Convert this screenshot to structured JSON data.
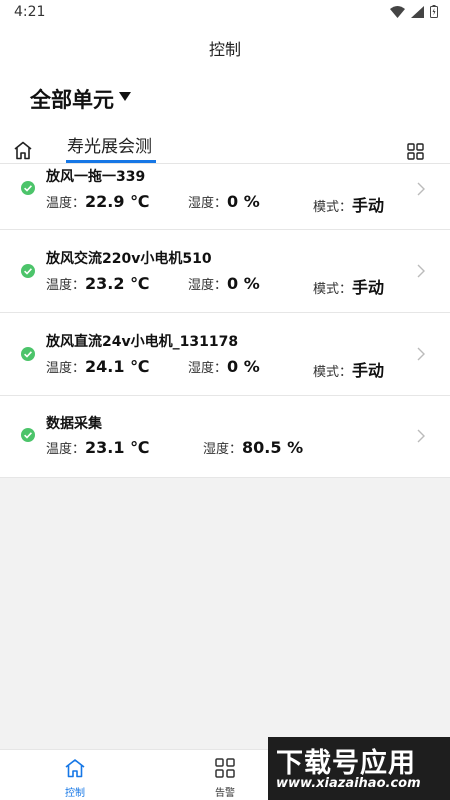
{
  "status": {
    "time": "4:21"
  },
  "header": {
    "title": "控制"
  },
  "unit": {
    "name": "全部单元"
  },
  "tabs": {
    "active": "寿光展会测"
  },
  "devices": [
    {
      "name": "放风一拖一339",
      "temp_label": "温度：",
      "temp_value": "22.9 ℃",
      "hum_label": "湿度：",
      "hum_value": "0 %",
      "mode_label": "模式：",
      "mode_value": "手动"
    },
    {
      "name": "放风交流220v小电机510",
      "temp_label": "温度：",
      "temp_value": "23.2 ℃",
      "hum_label": "湿度：",
      "hum_value": "0 %",
      "mode_label": "模式：",
      "mode_value": "手动"
    },
    {
      "name": "放风直流24v小电机_131178",
      "temp_label": "温度：",
      "temp_value": "24.1 ℃",
      "hum_label": "湿度：",
      "hum_value": "0 %",
      "mode_label": "模式：",
      "mode_value": "手动"
    },
    {
      "name": "数据采集",
      "temp_label": "温度：",
      "temp_value": "23.1 ℃",
      "hum_label": "湿度：",
      "hum_value": "80.5 %"
    }
  ],
  "bottom_nav": [
    {
      "label": "控制",
      "icon": "home-icon",
      "active": true
    },
    {
      "label": "告警",
      "icon": "grid-icon",
      "active": false
    }
  ],
  "watermark": {
    "main": "下载号应用",
    "sub": "www.xiazaihao.com"
  },
  "colors": {
    "accent": "#1677e6",
    "ok": "#4cc46a",
    "background": "#f2f2f2"
  }
}
